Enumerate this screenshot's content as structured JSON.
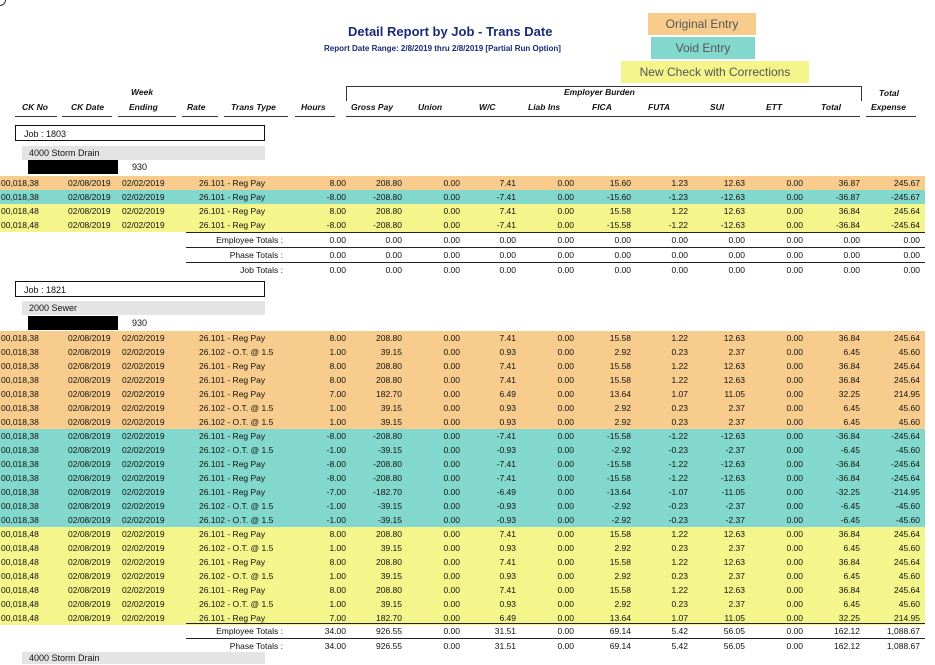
{
  "report": {
    "title": "Detail Report by Job - Trans Date",
    "date_range": "Report Date Range: 2/8/2019 thru 2/8/2019 [Partial Run Option]"
  },
  "legend": [
    {
      "label": "Original Entry",
      "color": "#f8cc8c"
    },
    {
      "label": "Void Entry",
      "color": "#82d8cc"
    },
    {
      "label": "New Check with Corrections",
      "color": "#f4f58a"
    }
  ],
  "colors": {
    "orange": "#f8cc8c",
    "teal": "#82d8cc",
    "yellow": "#f4f58a"
  },
  "headers": {
    "ck_no": "CK No",
    "ck_date": "CK Date",
    "week_top": "Week",
    "week_bottom": "Ending",
    "rate": "Rate",
    "trans_type": "Trans Type",
    "hours": "Hours",
    "gross_pay": "Gross Pay",
    "union": "Union",
    "wc": "W/C",
    "liab_ins": "Liab Ins",
    "fica": "FICA",
    "futa": "FUTA",
    "sui": "SUI",
    "ett": "ETT",
    "total": "Total",
    "total_top": "Total",
    "expense": "Expense",
    "employer_burden": "Employer Burden"
  },
  "jobs": [
    {
      "job_label": "Job : 1803",
      "dept": "4000 Storm Drain",
      "emp_no": "930",
      "rows": [
        {
          "band": "orange",
          "c": [
            "00,018,38",
            "02/08/2019",
            "02/02/2019",
            "26.101 - Reg Pay",
            "8.00",
            "208.80",
            "0.00",
            "7.41",
            "0.00",
            "15.60",
            "1.23",
            "12.63",
            "0.00",
            "36.87",
            "245.67"
          ]
        },
        {
          "band": "teal",
          "c": [
            "00,018,38",
            "02/08/2019",
            "02/02/2019",
            "26.101 - Reg Pay",
            "-8.00",
            "-208.80",
            "0.00",
            "-7.41",
            "0.00",
            "-15.60",
            "-1.23",
            "-12.63",
            "0.00",
            "-36.87",
            "-245.67"
          ]
        },
        {
          "band": "yellow",
          "c": [
            "00,018,48",
            "02/08/2019",
            "02/02/2019",
            "26.101 - Reg Pay",
            "8.00",
            "208.80",
            "0.00",
            "7.41",
            "0.00",
            "15.58",
            "1.22",
            "12.63",
            "0.00",
            "36.84",
            "245.64"
          ]
        },
        {
          "band": "yellow",
          "c": [
            "00,018,48",
            "02/08/2019",
            "02/02/2019",
            "26.101 - Reg Pay",
            "-8.00",
            "-208.80",
            "0.00",
            "-7.41",
            "0.00",
            "-15.58",
            "-1.22",
            "-12.63",
            "0.00",
            "-36.84",
            "-245.64"
          ]
        }
      ],
      "totals": [
        {
          "label": "Employee Totals :",
          "v": [
            "0.00",
            "0.00",
            "0.00",
            "0.00",
            "0.00",
            "0.00",
            "0.00",
            "0.00",
            "0.00",
            "0.00",
            "0.00"
          ]
        },
        {
          "label": "Phase Totals :",
          "v": [
            "0.00",
            "0.00",
            "0.00",
            "0.00",
            "0.00",
            "0.00",
            "0.00",
            "0.00",
            "0.00",
            "0.00",
            "0.00"
          ]
        },
        {
          "label": "Job Totals :",
          "v": [
            "0.00",
            "0.00",
            "0.00",
            "0.00",
            "0.00",
            "0.00",
            "0.00",
            "0.00",
            "0.00",
            "0.00",
            "0.00"
          ]
        }
      ]
    },
    {
      "job_label": "Job : 1821",
      "dept": "2000 Sewer",
      "emp_no": "930",
      "rows": [
        {
          "band": "orange",
          "c": [
            "00,018,38",
            "02/08/2019",
            "02/02/2019",
            "26.101 - Reg Pay",
            "8.00",
            "208.80",
            "0.00",
            "7.41",
            "0.00",
            "15.58",
            "1.22",
            "12.63",
            "0.00",
            "36.84",
            "245.64"
          ]
        },
        {
          "band": "orange",
          "c": [
            "00,018,38",
            "02/08/2019",
            "02/02/2019",
            "26.102 - O.T. @ 1.5",
            "1.00",
            "39.15",
            "0.00",
            "0.93",
            "0.00",
            "2.92",
            "0.23",
            "2.37",
            "0.00",
            "6.45",
            "45.60"
          ]
        },
        {
          "band": "orange",
          "c": [
            "00,018,38",
            "02/08/2019",
            "02/02/2019",
            "26.101 - Reg Pay",
            "8.00",
            "208.80",
            "0.00",
            "7.41",
            "0.00",
            "15.58",
            "1.22",
            "12.63",
            "0.00",
            "36.84",
            "245.64"
          ]
        },
        {
          "band": "orange",
          "c": [
            "00,018,38",
            "02/08/2019",
            "02/02/2019",
            "26.101 - Reg Pay",
            "8.00",
            "208.80",
            "0.00",
            "7.41",
            "0.00",
            "15.58",
            "1.22",
            "12.63",
            "0.00",
            "36.84",
            "245.64"
          ]
        },
        {
          "band": "orange",
          "c": [
            "00,018,38",
            "02/08/2019",
            "02/02/2019",
            "26.101 - Reg Pay",
            "7.00",
            "182.70",
            "0.00",
            "6.49",
            "0.00",
            "13.64",
            "1.07",
            "11.05",
            "0.00",
            "32.25",
            "214.95"
          ]
        },
        {
          "band": "orange",
          "c": [
            "00,018,38",
            "02/08/2019",
            "02/02/2019",
            "26.102 - O.T. @ 1.5",
            "1.00",
            "39.15",
            "0.00",
            "0.93",
            "0.00",
            "2.92",
            "0.23",
            "2.37",
            "0.00",
            "6.45",
            "45.60"
          ]
        },
        {
          "band": "orange",
          "c": [
            "00,018,38",
            "02/08/2019",
            "02/02/2019",
            "26.102 - O.T. @ 1.5",
            "1.00",
            "39.15",
            "0.00",
            "0.93",
            "0.00",
            "2.92",
            "0.23",
            "2.37",
            "0.00",
            "6.45",
            "45.60"
          ]
        },
        {
          "band": "teal",
          "c": [
            "00,018,38",
            "02/08/2019",
            "02/02/2019",
            "26.101 - Reg Pay",
            "-8.00",
            "-208.80",
            "0.00",
            "-7.41",
            "0.00",
            "-15.58",
            "-1.22",
            "-12.63",
            "0.00",
            "-36.84",
            "-245.64"
          ]
        },
        {
          "band": "teal",
          "c": [
            "00,018,38",
            "02/08/2019",
            "02/02/2019",
            "26.102 - O.T. @ 1.5",
            "-1.00",
            "-39.15",
            "0.00",
            "-0.93",
            "0.00",
            "-2.92",
            "-0.23",
            "-2.37",
            "0.00",
            "-6.45",
            "-45.60"
          ]
        },
        {
          "band": "teal",
          "c": [
            "00,018,38",
            "02/08/2019",
            "02/02/2019",
            "26.101 - Reg Pay",
            "-8.00",
            "-208.80",
            "0.00",
            "-7.41",
            "0.00",
            "-15.58",
            "-1.22",
            "-12.63",
            "0.00",
            "-36.84",
            "-245.64"
          ]
        },
        {
          "band": "teal",
          "c": [
            "00,018,38",
            "02/08/2019",
            "02/02/2019",
            "26.101 - Reg Pay",
            "-8.00",
            "-208.80",
            "0.00",
            "-7.41",
            "0.00",
            "-15.58",
            "-1.22",
            "-12.63",
            "0.00",
            "-36.84",
            "-245.64"
          ]
        },
        {
          "band": "teal",
          "c": [
            "00,018,38",
            "02/08/2019",
            "02/02/2019",
            "26.101 - Reg Pay",
            "-7.00",
            "-182.70",
            "0.00",
            "-6.49",
            "0.00",
            "-13.64",
            "-1.07",
            "-11.05",
            "0.00",
            "-32.25",
            "-214.95"
          ]
        },
        {
          "band": "teal",
          "c": [
            "00,018,38",
            "02/08/2019",
            "02/02/2019",
            "26.102 - O.T. @ 1.5",
            "-1.00",
            "-39.15",
            "0.00",
            "-0.93",
            "0.00",
            "-2.92",
            "-0.23",
            "-2.37",
            "0.00",
            "-6.45",
            "-45.60"
          ]
        },
        {
          "band": "teal",
          "c": [
            "00,018,38",
            "02/08/2019",
            "02/02/2019",
            "26.102 - O.T. @ 1.5",
            "-1.00",
            "-39.15",
            "0.00",
            "-0.93",
            "0.00",
            "-2.92",
            "-0.23",
            "-2.37",
            "0.00",
            "-6.45",
            "-45.60"
          ]
        },
        {
          "band": "yellow",
          "c": [
            "00,018,48",
            "02/08/2019",
            "02/02/2019",
            "26.101 - Reg Pay",
            "8.00",
            "208.80",
            "0.00",
            "7.41",
            "0.00",
            "15.58",
            "1.22",
            "12.63",
            "0.00",
            "36.84",
            "245.64"
          ]
        },
        {
          "band": "yellow",
          "c": [
            "00,018,48",
            "02/08/2019",
            "02/02/2019",
            "26.102 - O.T. @ 1.5",
            "1.00",
            "39.15",
            "0.00",
            "0.93",
            "0.00",
            "2.92",
            "0.23",
            "2.37",
            "0.00",
            "6.45",
            "45.60"
          ]
        },
        {
          "band": "yellow",
          "c": [
            "00,018,48",
            "02/08/2019",
            "02/02/2019",
            "26.101 - Reg Pay",
            "8.00",
            "208.80",
            "0.00",
            "7.41",
            "0.00",
            "15.58",
            "1.22",
            "12.63",
            "0.00",
            "36.84",
            "245.64"
          ]
        },
        {
          "band": "yellow",
          "c": [
            "00,018,48",
            "02/08/2019",
            "02/02/2019",
            "26.102 - O.T. @ 1.5",
            "1.00",
            "39.15",
            "0.00",
            "0.93",
            "0.00",
            "2.92",
            "0.23",
            "2.37",
            "0.00",
            "6.45",
            "45.60"
          ]
        },
        {
          "band": "yellow",
          "c": [
            "00,018,48",
            "02/08/2019",
            "02/02/2019",
            "26.101 - Reg Pay",
            "8.00",
            "208.80",
            "0.00",
            "7.41",
            "0.00",
            "15.58",
            "1.22",
            "12.63",
            "0.00",
            "36.84",
            "245.64"
          ]
        },
        {
          "band": "yellow",
          "c": [
            "00,018,48",
            "02/08/2019",
            "02/02/2019",
            "26.102 - O.T. @ 1.5",
            "1.00",
            "39.15",
            "0.00",
            "0.93",
            "0.00",
            "2.92",
            "0.23",
            "2.37",
            "0.00",
            "6.45",
            "45.60"
          ]
        },
        {
          "band": "yellow",
          "c": [
            "00,018,48",
            "02/08/2019",
            "02/02/2019",
            "26.101 - Reg Pay",
            "7.00",
            "182.70",
            "0.00",
            "6.49",
            "0.00",
            "13.64",
            "1.07",
            "11.05",
            "0.00",
            "32.25",
            "214.95"
          ]
        }
      ],
      "totals": [
        {
          "label": "Employee Totals :",
          "v": [
            "34.00",
            "926.55",
            "0.00",
            "31.51",
            "0.00",
            "69.14",
            "5.42",
            "56.05",
            "0.00",
            "162.12",
            "1,088.67"
          ]
        },
        {
          "label": "Phase Totals :",
          "v": [
            "34.00",
            "926.55",
            "0.00",
            "31.51",
            "0.00",
            "69.14",
            "5.42",
            "56.05",
            "0.00",
            "162.12",
            "1,088.67"
          ]
        }
      ]
    }
  ],
  "trailing_dept": "4000 Storm Drain"
}
